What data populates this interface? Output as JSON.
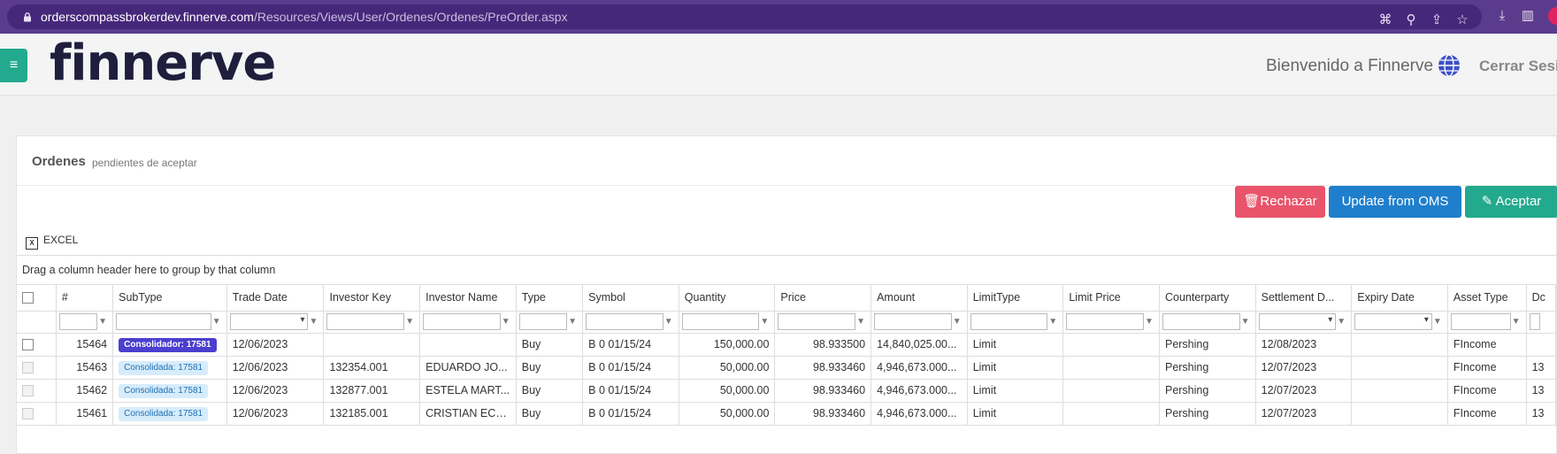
{
  "browser": {
    "url_host": "orderscompassbrokerdev.finnerve.com",
    "url_path": "/Resources/Views/User/Ordenes/Ordenes/PreOrder.aspx"
  },
  "header": {
    "logo": "finnerve",
    "welcome": "Bienvenido a Finnerve",
    "logout": "Cerrar Sesió"
  },
  "panel": {
    "title": "Ordenes",
    "subtitle": "pendientes de aceptar"
  },
  "actions": {
    "reject": "Rechazar",
    "update": "Update from OMS",
    "accept": "Aceptar",
    "excel": "EXCEL"
  },
  "group_hint": "Drag a column header here to group by that column",
  "columns": [
    "#",
    "SubType",
    "Trade Date",
    "Investor Key",
    "Investor Name",
    "Type",
    "Symbol",
    "Quantity",
    "Price",
    "Amount",
    "LimitType",
    "Limit Price",
    "Counterparty",
    "Settlement D...",
    "Expiry Date",
    "Asset Type",
    "Dc"
  ],
  "rows": [
    {
      "id": "15464",
      "subtype": "Consolidador: 17581",
      "trade_date": "12/06/2023",
      "investor_key": "",
      "investor_name": "",
      "type": "Buy",
      "symbol": "B 0 01/15/24",
      "quantity": "150,000.00",
      "price": "98.933500",
      "amount": "14,840,025.00...",
      "limit_type": "Limit",
      "limit_price": "",
      "counterparty": "Pershing",
      "settlement": "12/08/2023",
      "expiry": "",
      "asset_type": "FIncome",
      "dc": ""
    },
    {
      "id": "15463",
      "subtype": "Consolidada: 17581",
      "trade_date": "12/06/2023",
      "investor_key": "132354.001",
      "investor_name": "EDUARDO JO...",
      "type": "Buy",
      "symbol": "B 0 01/15/24",
      "quantity": "50,000.00",
      "price": "98.933460",
      "amount": "4,946,673.000...",
      "limit_type": "Limit",
      "limit_price": "",
      "counterparty": "Pershing",
      "settlement": "12/07/2023",
      "expiry": "",
      "asset_type": "FIncome",
      "dc": "13"
    },
    {
      "id": "15462",
      "subtype": "Consolidada: 17581",
      "trade_date": "12/06/2023",
      "investor_key": "132877.001",
      "investor_name": "ESTELA MART...",
      "type": "Buy",
      "symbol": "B 0 01/15/24",
      "quantity": "50,000.00",
      "price": "98.933460",
      "amount": "4,946,673.000...",
      "limit_type": "Limit",
      "limit_price": "",
      "counterparty": "Pershing",
      "settlement": "12/07/2023",
      "expiry": "",
      "asset_type": "FIncome",
      "dc": "13"
    },
    {
      "id": "15461",
      "subtype": "Consolidada: 17581",
      "trade_date": "12/06/2023",
      "investor_key": "132185.001",
      "investor_name": "CRISTIAN ECK...",
      "type": "Buy",
      "symbol": "B 0 01/15/24",
      "quantity": "50,000.00",
      "price": "98.933460",
      "amount": "4,946,673.000...",
      "limit_type": "Limit",
      "limit_price": "",
      "counterparty": "Pershing",
      "settlement": "12/07/2023",
      "expiry": "",
      "asset_type": "FIncome",
      "dc": "13"
    }
  ],
  "colors": {
    "browser": "#5b3b8c",
    "reject": "#e9546b",
    "update": "#1f7fcc",
    "accept": "#23a98d",
    "badge_dark": "#4a3fcf",
    "badge_light": "#d7ecfb"
  }
}
